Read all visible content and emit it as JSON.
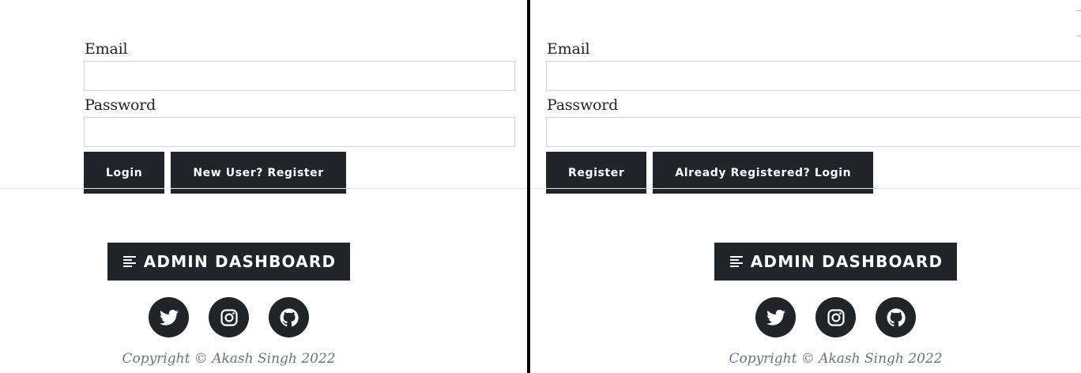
{
  "login_page": {
    "form": {
      "email_label": "Email",
      "email_value": "",
      "password_label": "Password",
      "password_value": "",
      "primary_button": "Login",
      "secondary_button": "New User? Register"
    },
    "footer": {
      "brand_icon": "text-lines-icon",
      "brand_label": "ADMIN DASHBOARD",
      "social": [
        "twitter-icon",
        "instagram-icon",
        "github-icon"
      ],
      "copyright": "Copyright © Akash Singh 2022"
    }
  },
  "register_page": {
    "form": {
      "email_label": "Email",
      "email_value": "",
      "password_label": "Password",
      "password_value": "",
      "primary_button": "Register",
      "secondary_button": "Already Registered? Login"
    },
    "footer": {
      "brand_icon": "text-lines-icon",
      "brand_label": "ADMIN DASHBOARD",
      "social": [
        "twitter-icon",
        "instagram-icon",
        "github-icon"
      ],
      "copyright": "Copyright © Akash Singh 2022"
    }
  },
  "colors": {
    "button_bg": "#212529",
    "button_text": "#ffffff",
    "input_border": "#ced4da",
    "muted_text": "#6c757d",
    "divider": "#000000"
  }
}
